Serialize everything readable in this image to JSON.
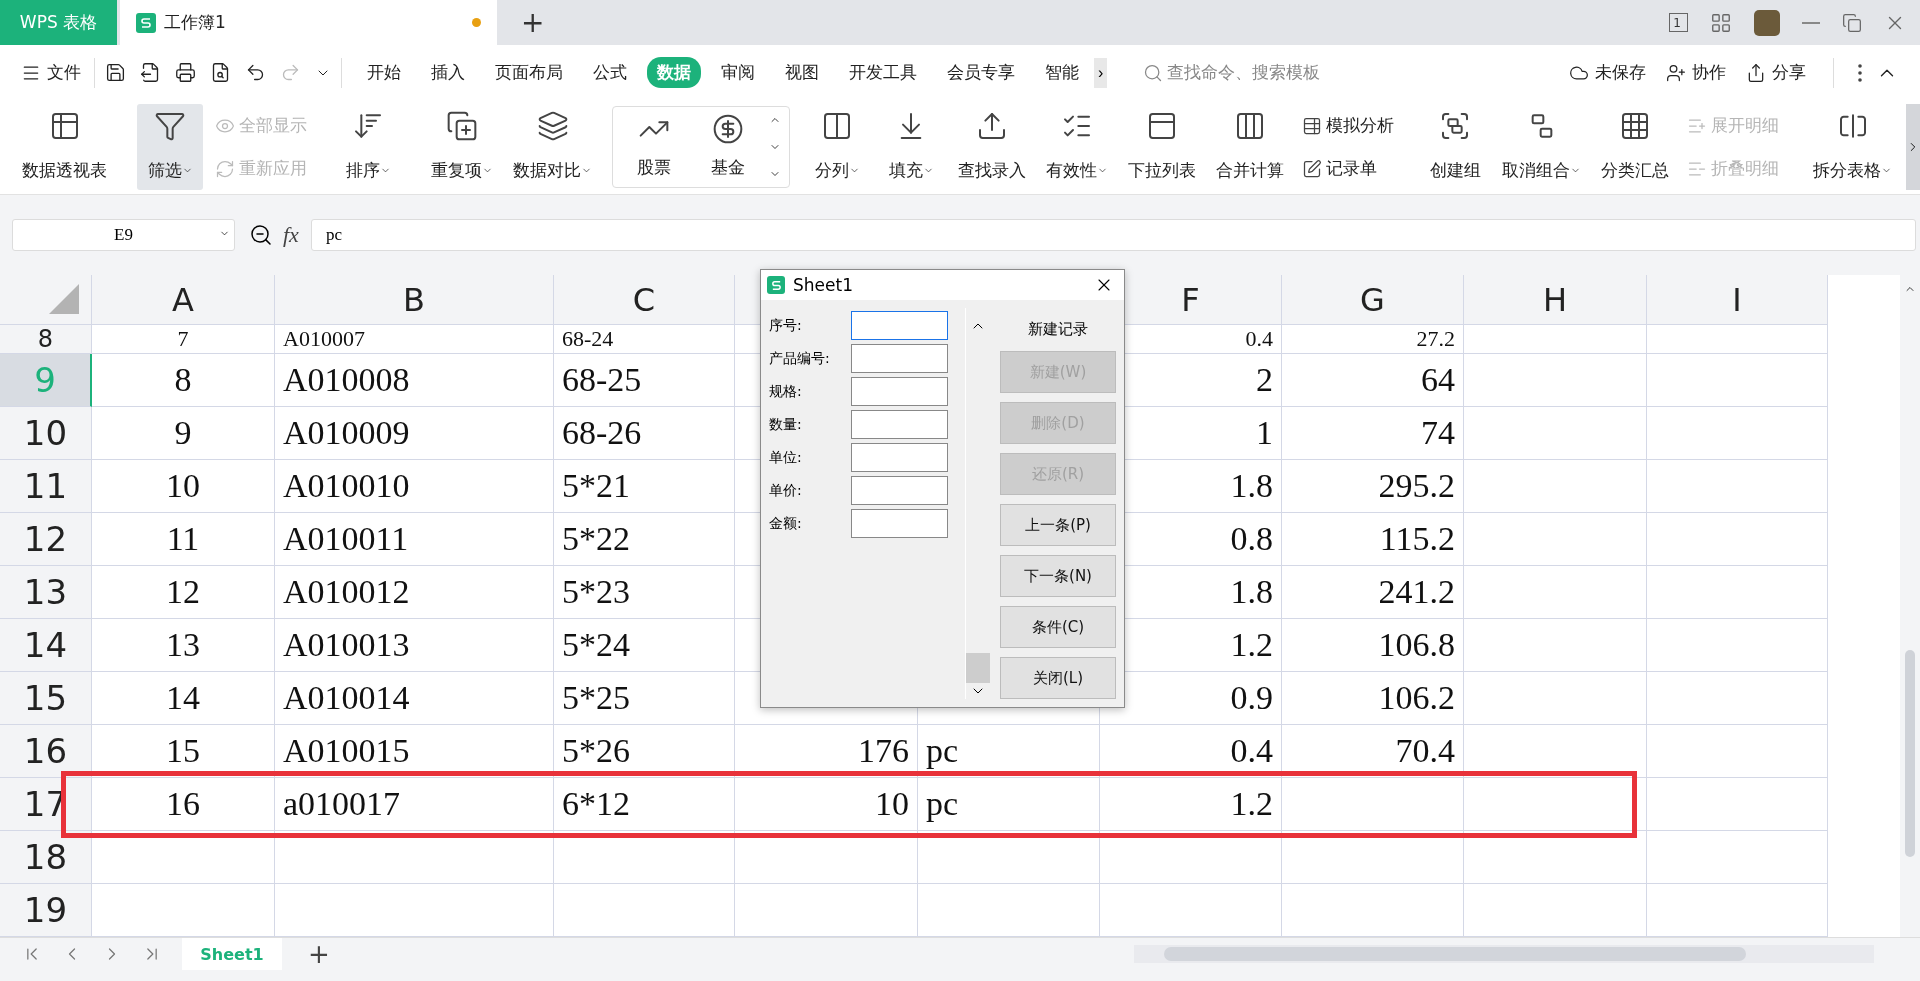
{
  "title_bar": {
    "app_tab": "WPS 表格",
    "document_tab": {
      "title": "工作簿1",
      "unsaved": true
    },
    "new_tab": "+",
    "page_count": "1"
  },
  "menu": {
    "file": "文件",
    "tabs": [
      {
        "label": "开始",
        "selected": false
      },
      {
        "label": "插入",
        "selected": false
      },
      {
        "label": "页面布局",
        "selected": false
      },
      {
        "label": "公式",
        "selected": false
      },
      {
        "label": "数据",
        "selected": true
      },
      {
        "label": "审阅",
        "selected": false
      },
      {
        "label": "视图",
        "selected": false
      },
      {
        "label": "开发工具",
        "selected": false
      },
      {
        "label": "会员专享",
        "selected": false
      },
      {
        "label": "智能",
        "selected": false
      }
    ],
    "more": "›",
    "search": {
      "placeholder": "查找命令、搜索模板"
    },
    "actions": [
      "未保存",
      "协作",
      "分享"
    ]
  },
  "ribbon": [
    {
      "kind": "buttons",
      "items": [
        {
          "label": "数据透视表",
          "kind": "large",
          "dropdown": false,
          "disabled": false,
          "pressed": false
        }
      ]
    },
    {
      "kind": "buttons",
      "items": [
        {
          "label": "筛选",
          "kind": "large",
          "dropdown": true,
          "disabled": false,
          "pressed": true
        },
        {
          "label": "全部显示",
          "kind": "small",
          "dropdown": false,
          "disabled": true,
          "pressed": false
        },
        {
          "label": "重新应用",
          "kind": "small",
          "dropdown": false,
          "disabled": true,
          "pressed": false
        }
      ]
    },
    {
      "kind": "buttons",
      "items": [
        {
          "label": "排序",
          "kind": "large",
          "dropdown": true,
          "disabled": false,
          "pressed": false
        }
      ]
    },
    {
      "kind": "buttons",
      "items": [
        {
          "label": "重复项",
          "kind": "large",
          "dropdown": true,
          "disabled": false,
          "pressed": false
        },
        {
          "label": "数据对比",
          "kind": "large",
          "dropdown": true,
          "disabled": false,
          "pressed": false
        }
      ]
    },
    {
      "kind": "gallery",
      "items": [
        {
          "label": "股票",
          "kind": "large",
          "dropdown": false,
          "disabled": false,
          "pressed": false
        },
        {
          "label": "基金",
          "kind": "large",
          "dropdown": false,
          "disabled": false,
          "pressed": false
        }
      ]
    },
    {
      "kind": "buttons",
      "items": [
        {
          "label": "分列",
          "kind": "large",
          "dropdown": true,
          "disabled": false,
          "pressed": false
        },
        {
          "label": "填充",
          "kind": "large",
          "dropdown": true,
          "disabled": false,
          "pressed": false
        },
        {
          "label": "查找录入",
          "kind": "large",
          "dropdown": false,
          "disabled": false,
          "pressed": false
        },
        {
          "label": "有效性",
          "kind": "large",
          "dropdown": true,
          "disabled": false,
          "pressed": false
        },
        {
          "label": "下拉列表",
          "kind": "large",
          "dropdown": false,
          "disabled": false,
          "pressed": false
        },
        {
          "label": "合并计算",
          "kind": "large",
          "dropdown": false,
          "disabled": false,
          "pressed": false
        },
        {
          "label": "模拟分析",
          "kind": "small",
          "dropdown": false,
          "disabled": false,
          "pressed": false
        },
        {
          "label": "记录单",
          "kind": "small",
          "dropdown": false,
          "disabled": false,
          "pressed": false
        }
      ]
    },
    {
      "kind": "buttons",
      "items": [
        {
          "label": "创建组",
          "kind": "large",
          "dropdown": false,
          "disabled": false,
          "pressed": false
        },
        {
          "label": "取消组合",
          "kind": "large",
          "dropdown": true,
          "disabled": false,
          "pressed": false
        },
        {
          "label": "分类汇总",
          "kind": "large",
          "dropdown": false,
          "disabled": false,
          "pressed": false
        },
        {
          "label": "展开明细",
          "kind": "small",
          "dropdown": false,
          "disabled": true,
          "pressed": false
        },
        {
          "label": "折叠明细",
          "kind": "small",
          "dropdown": false,
          "disabled": true,
          "pressed": false
        }
      ]
    },
    {
      "kind": "buttons",
      "items": [
        {
          "label": "拆分表格",
          "kind": "large",
          "dropdown": true,
          "disabled": false,
          "pressed": false
        }
      ]
    }
  ],
  "formula_bar": {
    "name_box": "E9",
    "fx": "fx",
    "value": "pc"
  },
  "sheet": {
    "column_headers": {
      "A": "A",
      "B": "B",
      "C": "C",
      "F": "F",
      "G": "G",
      "H": "H",
      "I": "I"
    },
    "rows": [
      {
        "header": "8",
        "selected": false,
        "partial": true,
        "cells": {
          "A": "7",
          "B": "A010007",
          "C": "68-24",
          "F": "0.4",
          "G": "27.2"
        }
      },
      {
        "header": "9",
        "selected": true,
        "partial": false,
        "cells": {
          "A": "8",
          "B": "A010008",
          "C": "68-25",
          "F": "2",
          "G": "64"
        }
      },
      {
        "header": "10",
        "selected": false,
        "partial": false,
        "cells": {
          "A": "9",
          "B": "A010009",
          "C": "68-26",
          "F": "1",
          "G": "74"
        }
      },
      {
        "header": "11",
        "selected": false,
        "partial": false,
        "cells": {
          "A": "10",
          "B": "A010010",
          "C": "5*21",
          "F": "1.8",
          "G": "295.2"
        }
      },
      {
        "header": "12",
        "selected": false,
        "partial": false,
        "cells": {
          "A": "11",
          "B": "A010011",
          "C": "5*22",
          "F": "0.8",
          "G": "115.2"
        }
      },
      {
        "header": "13",
        "selected": false,
        "partial": false,
        "cells": {
          "A": "12",
          "B": "A010012",
          "C": "5*23",
          "F": "1.8",
          "G": "241.2"
        }
      },
      {
        "header": "14",
        "selected": false,
        "partial": false,
        "cells": {
          "A": "13",
          "B": "A010013",
          "C": "5*24",
          "F": "1.2",
          "G": "106.8"
        }
      },
      {
        "header": "15",
        "selected": false,
        "partial": false,
        "cells": {
          "A": "14",
          "B": "A010014",
          "C": "5*25",
          "F": "0.9",
          "G": "106.2"
        }
      },
      {
        "header": "16",
        "selected": false,
        "partial": false,
        "cells": {
          "A": "15",
          "B": "A010015",
          "C": "5*26",
          "D": "176",
          "E": "pc",
          "F": "0.4",
          "G": "70.4"
        }
      },
      {
        "header": "17",
        "selected": false,
        "partial": false,
        "highlighted": true,
        "cells": {
          "A": "16",
          "B": "a010017",
          "C": "6*12",
          "D": "10",
          "E": "pc",
          "F": "1.2"
        }
      },
      {
        "header": "18",
        "selected": false,
        "partial": false,
        "cells": {}
      },
      {
        "header": "19",
        "selected": false,
        "partial": false,
        "cells": {}
      }
    ],
    "tabs": [
      {
        "label": "Sheet1",
        "selected": true
      }
    ],
    "add_sheet": "+"
  },
  "dialog": {
    "title": "Sheet1",
    "fields": [
      {
        "label": "序号:",
        "focused": true
      },
      {
        "label": "产品编号:",
        "focused": false
      },
      {
        "label": "规格:",
        "focused": false
      },
      {
        "label": "数量:",
        "focused": false
      },
      {
        "label": "单位:",
        "focused": false
      },
      {
        "label": "单价:",
        "focused": false
      },
      {
        "label": "金额:",
        "focused": false
      }
    ],
    "caption": "新建记录",
    "buttons": [
      {
        "label": "新建(W)",
        "disabled": true
      },
      {
        "label": "删除(D)",
        "disabled": true
      },
      {
        "label": "还原(R)",
        "disabled": true
      },
      {
        "label": "上一条(P)",
        "disabled": false
      },
      {
        "label": "下一条(N)",
        "disabled": false
      },
      {
        "label": "条件(C)",
        "disabled": false
      },
      {
        "label": "关闭(L)",
        "disabled": false
      }
    ]
  }
}
